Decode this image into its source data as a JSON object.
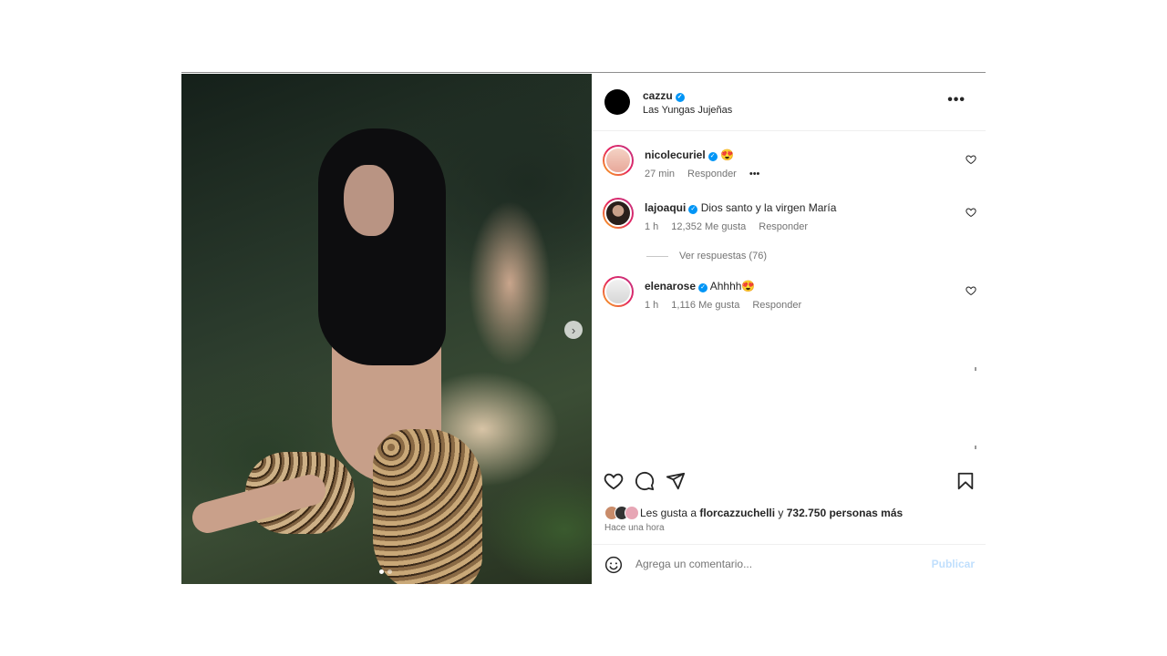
{
  "post": {
    "owner": "cazzu",
    "location": "Las Yungas Jujeñas",
    "more_icon": "more-horizontal-icon",
    "carousel": {
      "next_icon": "chevron-right-icon",
      "total": 2,
      "current": 1
    }
  },
  "comments": [
    {
      "user": "nicolecuriel",
      "text": "😍",
      "time": "27 min",
      "likes": "",
      "reply": "Responder",
      "more": "•••"
    },
    {
      "user": "lajoaqui",
      "text": "Dios santo y la virgen María",
      "time": "1 h",
      "likes": "12,352 Me gusta",
      "reply": "Responder"
    },
    {
      "user": "elenarose",
      "text": "Ahhhh😍",
      "time": "1 h",
      "likes": "1,116 Me gusta",
      "reply": "Responder"
    }
  ],
  "view_replies": "Ver respuestas (76)",
  "likes": {
    "prefix": "Les gusta a ",
    "user": "florcazzuchelli",
    "middle": " y ",
    "others": "732.750 personas más"
  },
  "posted_time": "Hace una hora",
  "add_comment": {
    "placeholder": "Agrega un comentario...",
    "publish": "Publicar"
  },
  "colors": {
    "verified": "#0095f6",
    "publish_disabled": "#c0dffd",
    "ring": "#e5245f"
  }
}
